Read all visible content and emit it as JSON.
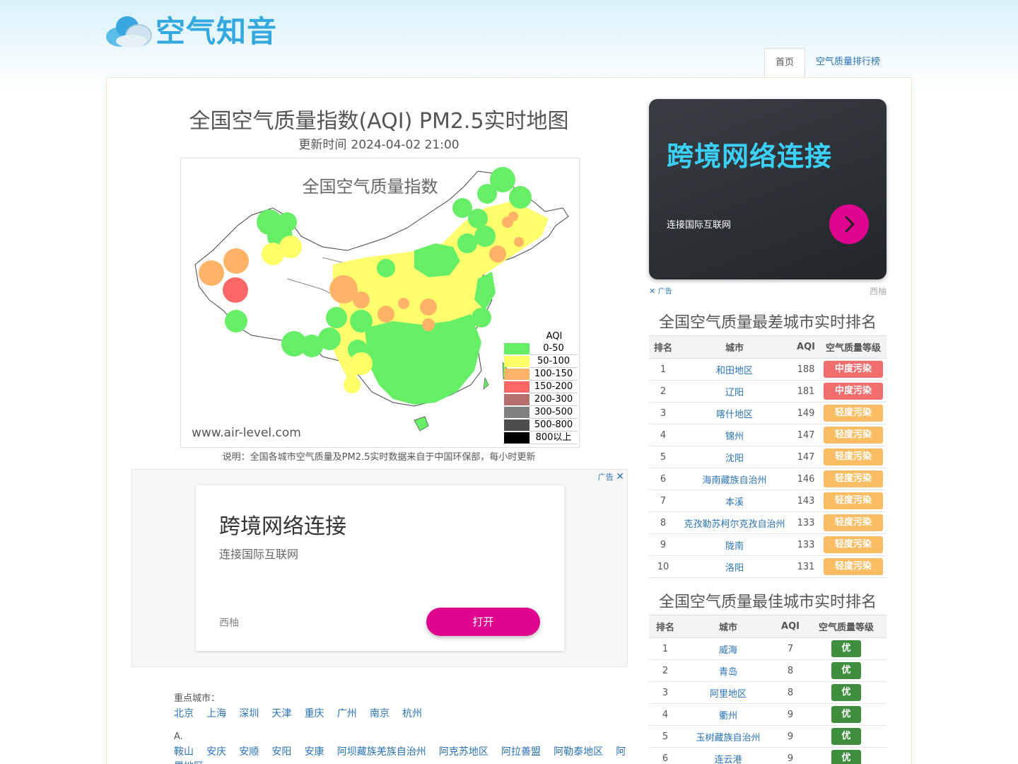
{
  "header": {
    "logo_text": "空气知音",
    "nav": [
      {
        "label": "首页",
        "active": true
      },
      {
        "label": "空气质量排行榜",
        "active": false
      }
    ]
  },
  "main": {
    "title": "全国空气质量指数(AQI) PM2.5实时地图",
    "update_label": "更新时间",
    "update_time": "2024-04-02 21:00",
    "map": {
      "title": "全国空气质量指数",
      "site": "www.air-level.com",
      "legend_title": "AQI",
      "legend": [
        {
          "label": "0-50",
          "color": "#66ee66"
        },
        {
          "label": "50-100",
          "color": "#ffff66"
        },
        {
          "label": "100-150",
          "color": "#ffb366"
        },
        {
          "label": "150-200",
          "color": "#ff6666"
        },
        {
          "label": "200-300",
          "color": "#b56f6f"
        },
        {
          "label": "300-500",
          "color": "#808080"
        },
        {
          "label": "500-800",
          "color": "#4d4d4d"
        },
        {
          "label": "800以上",
          "color": "#000000"
        }
      ]
    },
    "note": "说明：全国各城市空气质量及PM2.5实时数据来自于中国环保部，每小时更新",
    "ad": {
      "mark": "广告",
      "title": "跨境网络连接",
      "subtitle": "连接国际互联网",
      "brand": "西柚",
      "button": "打开"
    },
    "key_cities_label": "重点城市：",
    "key_cities": [
      "北京",
      "上海",
      "深圳",
      "天津",
      "重庆",
      "广州",
      "南京",
      "杭州"
    ],
    "group_a_label": "A.",
    "group_a": [
      "鞍山",
      "安庆",
      "安顺",
      "安阳",
      "安康",
      "阿坝藏族羌族自治州",
      "阿克苏地区",
      "阿拉善盟",
      "阿勒泰地区",
      "阿里地区"
    ]
  },
  "side": {
    "ad": {
      "title": "跨境网络连接",
      "subtitle": "连接国际互联网",
      "mark": "广告",
      "brand": "西柚",
      "accent": "#3ad0f7",
      "button_color": "#e0058f"
    },
    "worst": {
      "title": "全国空气质量最差城市实时排名",
      "headers": [
        "排名",
        "城市",
        "AQI",
        "空气质量等级"
      ],
      "rows": [
        {
          "rank": "1",
          "city": "和田地区",
          "aqi": "188",
          "level": "中度污染",
          "cls": "mid"
        },
        {
          "rank": "2",
          "city": "辽阳",
          "aqi": "181",
          "level": "中度污染",
          "cls": "mid"
        },
        {
          "rank": "3",
          "city": "喀什地区",
          "aqi": "149",
          "level": "轻度污染",
          "cls": "light"
        },
        {
          "rank": "4",
          "city": "锦州",
          "aqi": "147",
          "level": "轻度污染",
          "cls": "light"
        },
        {
          "rank": "5",
          "city": "沈阳",
          "aqi": "147",
          "level": "轻度污染",
          "cls": "light"
        },
        {
          "rank": "6",
          "city": "海南藏族自治州",
          "aqi": "146",
          "level": "轻度污染",
          "cls": "light"
        },
        {
          "rank": "7",
          "city": "本溪",
          "aqi": "143",
          "level": "轻度污染",
          "cls": "light"
        },
        {
          "rank": "8",
          "city": "克孜勒苏柯尔克孜自治州",
          "aqi": "133",
          "level": "轻度污染",
          "cls": "light"
        },
        {
          "rank": "9",
          "city": "陇南",
          "aqi": "133",
          "level": "轻度污染",
          "cls": "light"
        },
        {
          "rank": "10",
          "city": "洛阳",
          "aqi": "131",
          "level": "轻度污染",
          "cls": "light"
        }
      ]
    },
    "best": {
      "title": "全国空气质量最佳城市实时排名",
      "headers": [
        "排名",
        "城市",
        "AQI",
        "空气质量等级"
      ],
      "rows": [
        {
          "rank": "1",
          "city": "威海",
          "aqi": "7",
          "level": "优",
          "cls": "good"
        },
        {
          "rank": "2",
          "city": "青岛",
          "aqi": "8",
          "level": "优",
          "cls": "good"
        },
        {
          "rank": "3",
          "city": "阿里地区",
          "aqi": "8",
          "level": "优",
          "cls": "good"
        },
        {
          "rank": "4",
          "city": "衢州",
          "aqi": "9",
          "level": "优",
          "cls": "good"
        },
        {
          "rank": "5",
          "city": "玉树藏族自治州",
          "aqi": "9",
          "level": "优",
          "cls": "good"
        },
        {
          "rank": "6",
          "city": "连云港",
          "aqi": "9",
          "level": "优",
          "cls": "good"
        }
      ]
    }
  }
}
